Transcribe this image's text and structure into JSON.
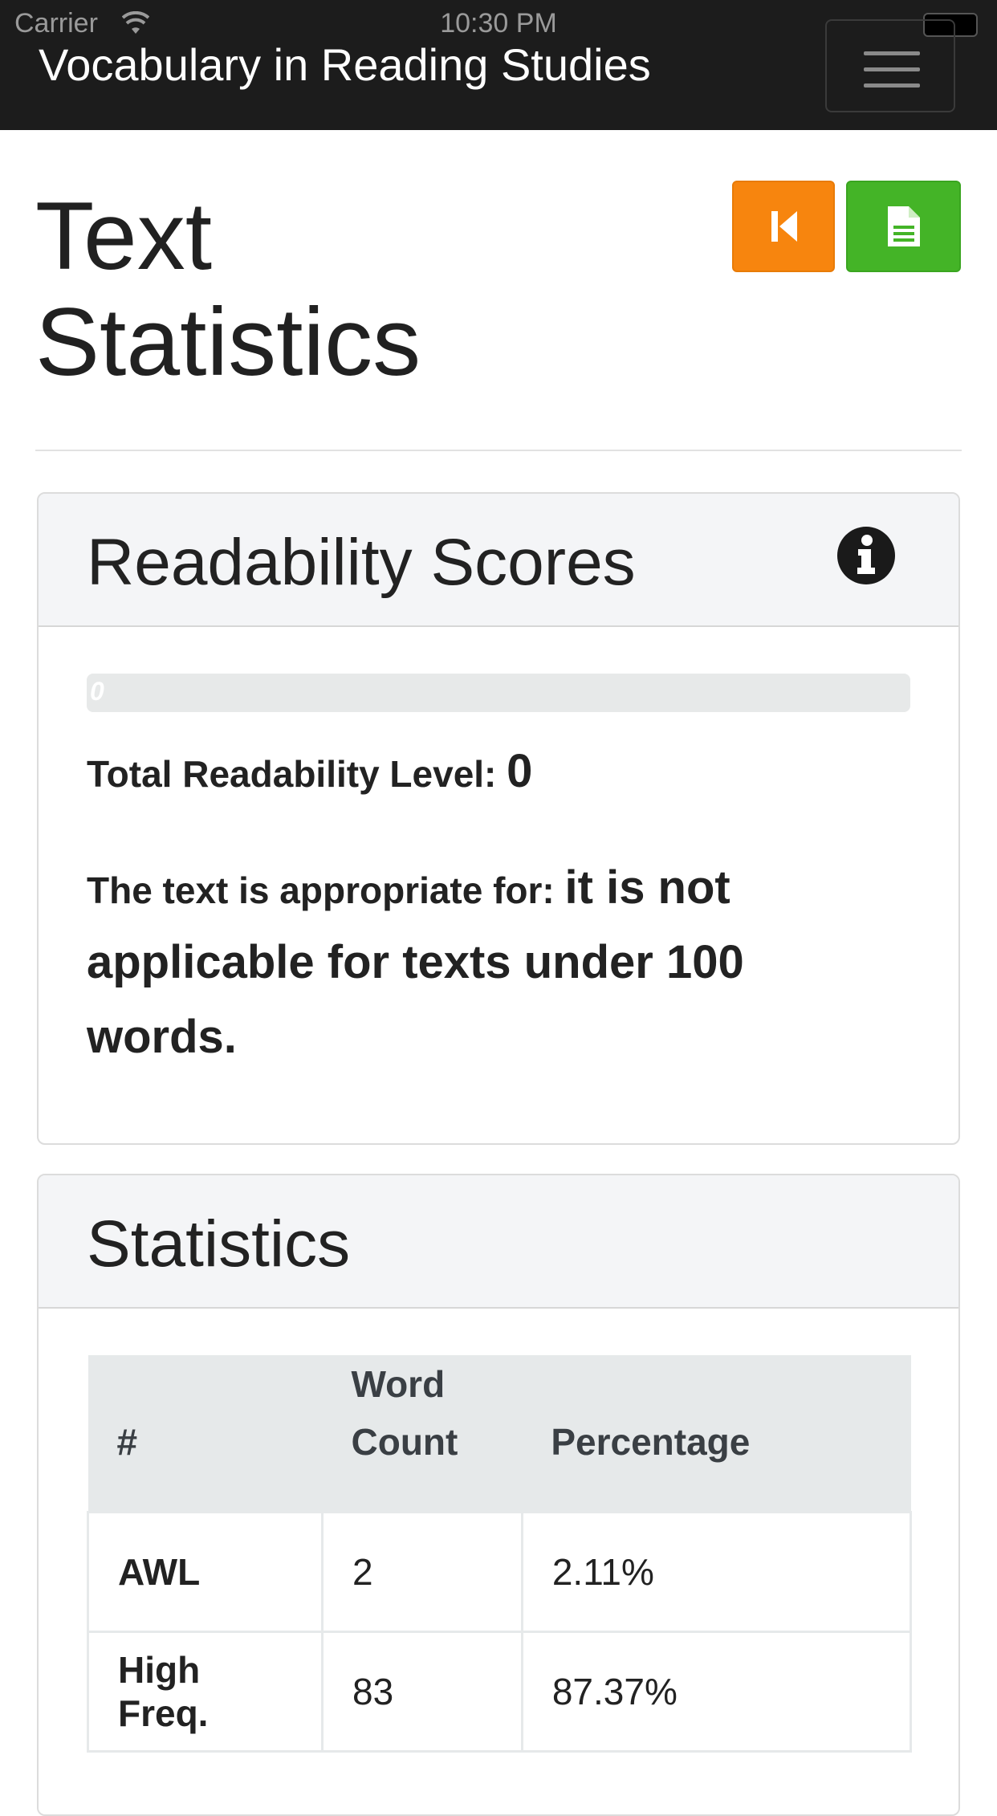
{
  "status_bar": {
    "carrier": "Carrier",
    "time": "10:30 PM"
  },
  "navbar": {
    "brand": "Vocabulary in Reading Studies"
  },
  "header": {
    "title": "Text Statistics"
  },
  "icons": {
    "wifi": "wifi-icon",
    "battery": "battery-icon",
    "menu": "hamburger-menu-icon",
    "back": "skip-back-icon",
    "document": "document-icon",
    "info": "info-icon"
  },
  "colors": {
    "back_button": "#f7850e",
    "document_button": "#44b427",
    "navbar": "#1c1c1c"
  },
  "readability": {
    "heading": "Readability Scores",
    "progress_value": 0,
    "progress_label": "0",
    "total_label": "Total Readability Level:",
    "total_value": "0",
    "appropriate_label": "The text is appropriate for:",
    "appropriate_value": "it is not applicable for texts under 100 words."
  },
  "statistics": {
    "heading": "Statistics",
    "columns": [
      "#",
      "Word Count",
      "Percentage"
    ],
    "rows": [
      {
        "label": "AWL",
        "word_count": "2",
        "percentage": "2.11%"
      },
      {
        "label": "High Freq.",
        "word_count": "83",
        "percentage": "87.37%"
      }
    ]
  }
}
